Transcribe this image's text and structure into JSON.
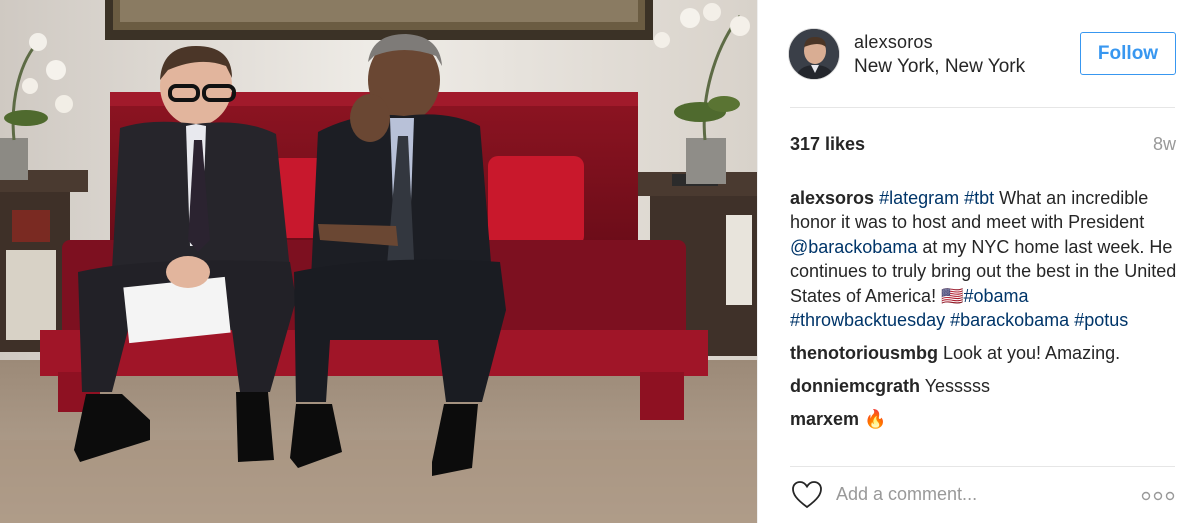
{
  "post": {
    "photo_icon": "photo-image",
    "username": "alexsoros",
    "location": "New York, New York",
    "follow_label": "Follow",
    "likes": "317 likes",
    "time_ago": "8w",
    "caption": {
      "username": "alexsoros",
      "segments": [
        {
          "text": "#lategram",
          "link": true
        },
        {
          "text": " ",
          "link": false
        },
        {
          "text": "#tbt",
          "link": true
        },
        {
          "text": " What an incredible honor it was to host and meet with President ",
          "link": false
        },
        {
          "text": "@barackobama",
          "link": true
        },
        {
          "text": " at my NYC home last week. He continues to truly bring out the best in the United States of America! ",
          "link": false
        },
        {
          "text": "🇺🇸",
          "link": false
        },
        {
          "text": "#obama",
          "link": true
        },
        {
          "text": " ",
          "link": false
        },
        {
          "text": "#throwbacktuesday",
          "link": true
        },
        {
          "text": " ",
          "link": false
        },
        {
          "text": "#barackobama",
          "link": true
        },
        {
          "text": " ",
          "link": false
        },
        {
          "text": "#potus",
          "link": true
        }
      ]
    },
    "comments": [
      {
        "username": "thenotoriousmbg",
        "text": "Look at you! Amazing."
      },
      {
        "username": "donniemcgrath",
        "text": "Yesssss"
      },
      {
        "username": "marxem",
        "text": "🔥"
      }
    ],
    "add_comment_placeholder": "Add a comment...",
    "like_icon": "heart-outline-icon",
    "more_icon": "more-options-icon"
  },
  "colors": {
    "link": "#003569",
    "follow_blue": "#3897f0",
    "muted": "#999999",
    "text": "#262626"
  }
}
